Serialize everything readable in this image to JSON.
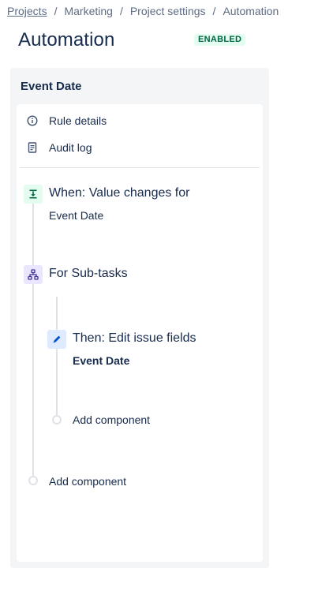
{
  "breadcrumb": {
    "items": [
      "Projects",
      "Marketing",
      "Project settings",
      "Automation"
    ],
    "separator": "/"
  },
  "page": {
    "title": "Automation",
    "status": "ENABLED"
  },
  "rule": {
    "name": "Event Date",
    "menu": [
      {
        "label": "Rule details",
        "icon": "info-icon"
      },
      {
        "label": "Audit log",
        "icon": "document-icon"
      }
    ],
    "trigger": {
      "title": "When: Value changes for",
      "field": "Event Date",
      "icon": "trigger-icon",
      "color": "#e3fcef"
    },
    "branch": {
      "title": "For Sub-tasks",
      "icon": "branch-icon",
      "color": "#eae6ff"
    },
    "action": {
      "title": "Then: Edit issue fields",
      "field": "Event Date",
      "icon": "pencil-icon",
      "color": "#deebff"
    },
    "add_component_inner": "Add component",
    "add_component_outer": "Add component"
  }
}
